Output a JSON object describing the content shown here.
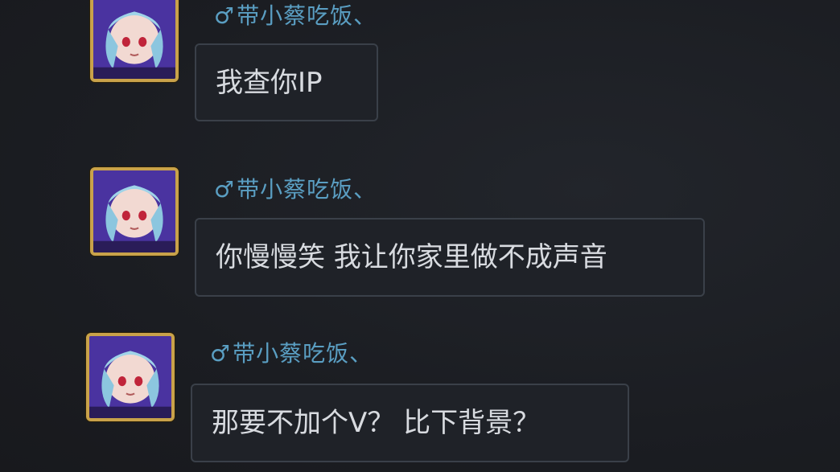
{
  "messages": [
    {
      "gender_symbol": "♂",
      "username": "带小蔡吃饭、",
      "text": "我查你IP"
    },
    {
      "gender_symbol": "♂",
      "username": "带小蔡吃饭、",
      "text": "你慢慢笑 我让你家里做不成声音"
    },
    {
      "gender_symbol": "♂",
      "username": "带小蔡吃饭、",
      "text": "那要不加个V？ 比下背景？"
    }
  ],
  "colors": {
    "background": "#1b1d22",
    "username": "#5a9ec2",
    "bubble_border": "#3a4049",
    "bubble_text": "#d8dbe0",
    "avatar_frame": "#c9a24a"
  }
}
